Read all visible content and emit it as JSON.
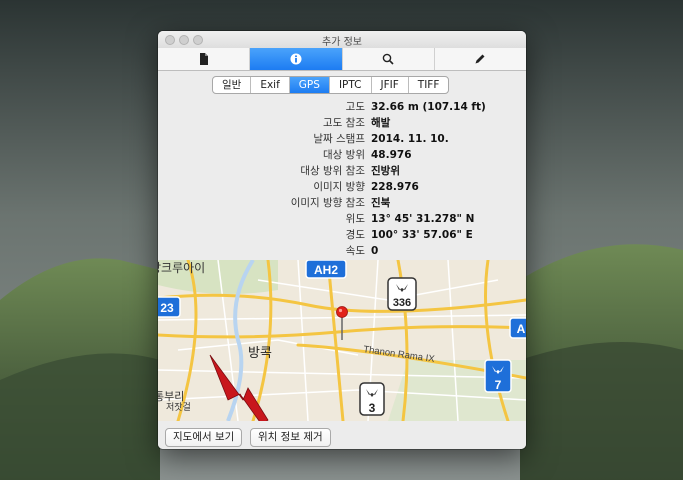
{
  "window": {
    "title": "추가 정보"
  },
  "toolbar": {
    "tabs": [
      {
        "icon": "document-icon",
        "active": false
      },
      {
        "icon": "info-icon",
        "active": true
      },
      {
        "icon": "magnifier-icon",
        "active": false
      },
      {
        "icon": "pencil-icon",
        "active": false
      }
    ]
  },
  "segments": {
    "items": [
      "일반",
      "Exif",
      "GPS",
      "IPTC",
      "JFIF",
      "TIFF"
    ],
    "selected": "GPS"
  },
  "gps": {
    "rows": [
      {
        "label": "고도",
        "value": "32.66 m (107.14 ft)"
      },
      {
        "label": "고도 참조",
        "value": "해발"
      },
      {
        "label": "날짜 스탬프",
        "value": "2014. 11. 10."
      },
      {
        "label": "대상 방위",
        "value": "48.976"
      },
      {
        "label": "대상 방위 참조",
        "value": "진방위"
      },
      {
        "label": "이미지 방향",
        "value": "228.976"
      },
      {
        "label": "이미지 방향 참조",
        "value": "진북"
      },
      {
        "label": "위도",
        "value": "13° 45' 31.278\" N"
      },
      {
        "label": "경도",
        "value": "100° 33' 57.06\" E"
      },
      {
        "label": "속도",
        "value": "0"
      }
    ]
  },
  "map": {
    "labels": {
      "district_top": "방크루아이",
      "city": "방콕",
      "district_bottom": "통부리",
      "district_bottom2": "저잣걸",
      "road": "Thanon Rama IX"
    },
    "shields": {
      "ah2": "AH2",
      "r23": "23",
      "r336": "336",
      "r3": "3",
      "r7": "7",
      "right_edge": "A"
    },
    "colors": {
      "highway": "#f4c542",
      "shield_blue": "#1e6fd9",
      "shield_green": "#2e9a3e",
      "pin": "#e2231a"
    }
  },
  "buttons": {
    "show_in_maps": "지도에서 보기",
    "remove_location": "위치 정보 제거"
  }
}
